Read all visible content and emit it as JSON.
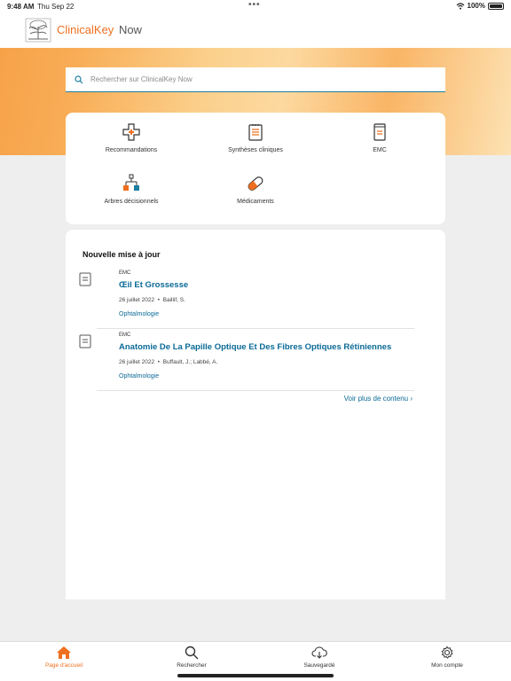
{
  "status": {
    "time": "9:48 AM",
    "date": "Thu Sep 22",
    "battery": "100%"
  },
  "header": {
    "brand_main": "ClinicalKey",
    "brand_sub": "Now"
  },
  "search": {
    "placeholder": "Rechercher sur ClinicalKey Now",
    "icon": "search-icon"
  },
  "categories": [
    {
      "label": "Recommandations",
      "icon": "medical-cross-icon"
    },
    {
      "label": "Synthèses cliniques",
      "icon": "clipboard-icon"
    },
    {
      "label": "EMC",
      "icon": "document-icon"
    },
    {
      "label": "Arbres décisionnels",
      "icon": "decision-tree-icon"
    },
    {
      "label": "Médicaments",
      "icon": "pill-icon"
    }
  ],
  "updates": {
    "heading": "Nouvelle mise à jour",
    "articles": [
      {
        "source": "EMC",
        "title": "Œil Et Grossesse",
        "date": "26 juillet 2022",
        "authors": "Baillif, S.",
        "tag": "Ophtalmologie"
      },
      {
        "source": "EMC",
        "title": "Anatomie De La Papille Optique Et Des Fibres Optiques Rétiniennes",
        "date": "26 juillet 2022",
        "authors": "Buffault, J.; Labbé, A.",
        "tag": "Ophtalmologie"
      }
    ],
    "more_link": "Voir plus de contenu"
  },
  "tabs": [
    {
      "label": "Page d'accueil",
      "icon": "home-icon",
      "active": true
    },
    {
      "label": "Rechercher",
      "icon": "search-icon"
    },
    {
      "label": "Sauvegardé",
      "icon": "cloud-download-icon"
    },
    {
      "label": "Mon compte",
      "icon": "gear-icon"
    }
  ],
  "colors": {
    "accent": "#ee6f1f",
    "link": "#0b6a96",
    "background": "#eeeeee"
  }
}
